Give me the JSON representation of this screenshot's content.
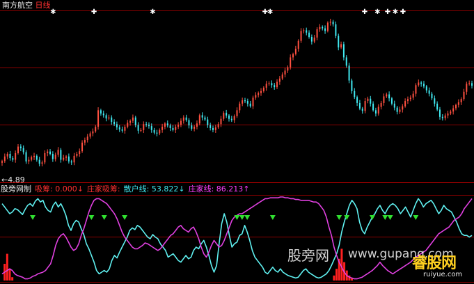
{
  "header": {
    "stock_name": "南方航空",
    "period": "日线"
  },
  "price_panel": {
    "low_marker_label": "4.89"
  },
  "indicator_bar": {
    "name": "股旁网制",
    "items": [
      {
        "label": "吸筹:",
        "value": "0.000",
        "arrow": "↓",
        "label_color": "#ff3030",
        "value_color": "#ff3030"
      },
      {
        "label": "庄家吸筹:",
        "value": "",
        "arrow": "",
        "label_color": "#ff3030",
        "value_color": "#ff3030"
      },
      {
        "label": "散户线:",
        "value": "53.822",
        "arrow": "↓",
        "label_color": "#40e8f0",
        "value_color": "#40e8f0"
      },
      {
        "label": "庄家线:",
        "value": "86.213",
        "arrow": "↑",
        "label_color": "#ff40ff",
        "value_color": "#ff40ff"
      }
    ]
  },
  "watermarks": {
    "site_cn": "股旁网",
    "site_url": "www.gupang.com",
    "brand_cn": "睿股网",
    "brand_url": "ruiyue.com"
  },
  "colors": {
    "background": "#000000",
    "up_candle": "#ff5040",
    "down_candle": "#40e8f0",
    "retail_line": "#5ff0f0",
    "banker_line": "#e040e0",
    "accumulation": "#ff2020",
    "marker": "#30e030",
    "grid": "#8b0000"
  },
  "chart_data": [
    {
      "type": "candlestick",
      "title": "南方航空 日线",
      "ylim": [
        4.5,
        9.6
      ],
      "min_price": 4.89,
      "close": [
        5.06,
        5.2,
        5.28,
        5.15,
        5.1,
        5.3,
        5.5,
        5.45,
        5.33,
        5.05,
        5.1,
        5.18,
        5.22,
        5.1,
        4.98,
        5.02,
        5.3,
        5.35,
        5.28,
        5.12,
        5.25,
        5.4,
        5.1,
        5.16,
        5.2,
        5.05,
        5.02,
        5.22,
        5.28,
        5.36,
        5.62,
        5.7,
        5.8,
        5.9,
        5.96,
        6.1,
        6.6,
        6.5,
        6.45,
        6.35,
        6.38,
        6.25,
        6.18,
        6.08,
        6.02,
        5.98,
        6.1,
        6.22,
        6.28,
        6.38,
        6.15,
        5.98,
        6.0,
        6.18,
        6.16,
        6.12,
        6.0,
        5.92,
        5.9,
        6.0,
        6.1,
        6.2,
        6.14,
        6.06,
        6.0,
        6.1,
        6.16,
        6.28,
        6.38,
        6.3,
        6.14,
        6.04,
        6.1,
        6.2,
        6.45,
        6.38,
        6.32,
        6.15,
        6.06,
        6.0,
        6.08,
        6.18,
        6.34,
        6.52,
        6.44,
        6.34,
        6.3,
        6.42,
        6.6,
        6.8,
        6.9,
        6.88,
        6.8,
        6.72,
        6.98,
        7.06,
        7.12,
        7.18,
        7.28,
        7.4,
        7.42,
        7.36,
        7.3,
        7.46,
        7.56,
        7.68,
        7.8,
        7.9,
        8.2,
        8.3,
        8.46,
        8.7,
        9.0,
        9.02,
        8.95,
        8.82,
        8.68,
        8.8,
        9.05,
        9.12,
        9.08,
        9.0,
        9.25,
        9.28,
        9.2,
        8.85,
        8.5,
        8.6,
        8.2,
        7.95,
        7.5,
        7.18,
        7.0,
        6.82,
        6.65,
        6.58,
        6.88,
        6.95,
        6.8,
        6.6,
        6.5,
        6.7,
        6.82,
        7.02,
        7.08,
        6.96,
        6.8,
        6.68,
        6.55,
        6.62,
        6.72,
        6.88,
        6.94,
        6.98,
        7.1,
        7.36,
        7.44,
        7.4,
        7.32,
        7.2,
        7.1,
        6.96,
        6.8,
        6.62,
        6.4,
        6.36,
        6.44,
        6.5,
        6.56,
        6.66,
        6.76,
        6.84,
        6.94,
        7.16,
        7.4,
        7.42,
        7.34
      ]
    },
    {
      "type": "line",
      "title": "股旁网制",
      "ylim": [
        0,
        100
      ],
      "series": [
        {
          "name": "散户线",
          "values": [
            92,
            88,
            84,
            80,
            82,
            86,
            85,
            82,
            79,
            85,
            90,
            92,
            89,
            95,
            98,
            94,
            96,
            88,
            84,
            82,
            90,
            94,
            88,
            92,
            86,
            78,
            66,
            60,
            68,
            72,
            70,
            62,
            55,
            44,
            38,
            30,
            22,
            12,
            8,
            10,
            12,
            10,
            14,
            24,
            30,
            27,
            34,
            40,
            46,
            52,
            60,
            63,
            61,
            66,
            64,
            60,
            56,
            52,
            50,
            55,
            52,
            50,
            44,
            40,
            36,
            28,
            30,
            32,
            28,
            24,
            22,
            26,
            30,
            26,
            28,
            36,
            40,
            38,
            44,
            48,
            40,
            30,
            18,
            10,
            18,
            44,
            68,
            80,
            70,
            54,
            40,
            44,
            46,
            54,
            56,
            66,
            58,
            48,
            36,
            28,
            24,
            20,
            16,
            10,
            8,
            12,
            16,
            12,
            10,
            14,
            10,
            8,
            6,
            5,
            4,
            3,
            4,
            8,
            12,
            14,
            10,
            8,
            6,
            4,
            3,
            4,
            6,
            8,
            12,
            18,
            25,
            32,
            42,
            58,
            70,
            80,
            90,
            96,
            92,
            86,
            70,
            60,
            56,
            64,
            70,
            76,
            80,
            86,
            90,
            84,
            80,
            86,
            90,
            92,
            90,
            86,
            80,
            84,
            88,
            82,
            76,
            84,
            92,
            98,
            94,
            88,
            92,
            94,
            96,
            92,
            86,
            80,
            84,
            90,
            86,
            84,
            82,
            76,
            70,
            62,
            56,
            54,
            54,
            52,
            54
          ]
        },
        {
          "name": "庄家线",
          "values": [
            8,
            10,
            12,
            14,
            12,
            8,
            6,
            5,
            4,
            2,
            2,
            3,
            5,
            6,
            8,
            9,
            10,
            12,
            16,
            20,
            30,
            42,
            50,
            54,
            56,
            52,
            46,
            40,
            36,
            38,
            44,
            54,
            62,
            72,
            82,
            90,
            96,
            98,
            98,
            96,
            94,
            92,
            88,
            84,
            80,
            74,
            66,
            58,
            52,
            48,
            44,
            40,
            38,
            38,
            40,
            42,
            45,
            44,
            42,
            40,
            38,
            36,
            38,
            42,
            46,
            50,
            54,
            56,
            60,
            64,
            66,
            62,
            60,
            58,
            62,
            64,
            58,
            50,
            40,
            32,
            28,
            34,
            42,
            48,
            44,
            40,
            42,
            48,
            56,
            64,
            72,
            76,
            78,
            80,
            80,
            82,
            84,
            86,
            88,
            90,
            92,
            94,
            96,
            98,
            98,
            99,
            99,
            99,
            99,
            100,
            100,
            99,
            99,
            98,
            98,
            97,
            97,
            96,
            96,
            96,
            96,
            95,
            94,
            94,
            92,
            88,
            84,
            76,
            64,
            54,
            40,
            30,
            22,
            16,
            10,
            6,
            4,
            3,
            2,
            2,
            3,
            4,
            6,
            8,
            10,
            12,
            15,
            18,
            22,
            18,
            15,
            12,
            10,
            8,
            10,
            12,
            14,
            16,
            18,
            20,
            22,
            25,
            28,
            30,
            32,
            34,
            36,
            40,
            44,
            48,
            52,
            56,
            58,
            60,
            62,
            64,
            68,
            72,
            74,
            76,
            80,
            86,
            90,
            94,
            98
          ]
        },
        {
          "name": "吸筹",
          "values": [
            0,
            20,
            32,
            14,
            4,
            0,
            0,
            0,
            0,
            0,
            0,
            0,
            0,
            0,
            0,
            0,
            0,
            0,
            0,
            0,
            0,
            0,
            0,
            0,
            0,
            0,
            0,
            0,
            0,
            0,
            0,
            0,
            0,
            0,
            0,
            0,
            0,
            0,
            0,
            0,
            0,
            0,
            0,
            0,
            0,
            0,
            0,
            0,
            0,
            0,
            0,
            0,
            0,
            0,
            0,
            0,
            0,
            0,
            0,
            0,
            0,
            0,
            0,
            0,
            0,
            0,
            0,
            0,
            0,
            0,
            0,
            0,
            0,
            0,
            0,
            0,
            0,
            0,
            0,
            0,
            0,
            0,
            0,
            0,
            0,
            0,
            0,
            0,
            0,
            0,
            0,
            0,
            0,
            0,
            0,
            0,
            0,
            0,
            0,
            0,
            0,
            0,
            0,
            0,
            0,
            0,
            0,
            0,
            0,
            0,
            0,
            0,
            0,
            0,
            0,
            0,
            0,
            0,
            0,
            0,
            0,
            0,
            0,
            0,
            0,
            0,
            0,
            0,
            0,
            0,
            6,
            14,
            26,
            38,
            22,
            12,
            6,
            3,
            0,
            0,
            0,
            0,
            0,
            0,
            0,
            0,
            0,
            0,
            0,
            0,
            0,
            0,
            0,
            0,
            0,
            0,
            0,
            0,
            0,
            0,
            0,
            0,
            0,
            0,
            0,
            0,
            0,
            0,
            0,
            0,
            0,
            0,
            0,
            0,
            0,
            0,
            0,
            0,
            0,
            0
          ]
        }
      ],
      "signal_marker_indices": [
        12,
        35,
        40,
        48,
        92,
        94,
        96,
        106,
        132,
        135,
        145,
        150,
        152,
        162,
        192
      ],
      "annotation_marker_indices": [
        20,
        36,
        59,
        103,
        105,
        142,
        147,
        151,
        154,
        157
      ]
    }
  ]
}
